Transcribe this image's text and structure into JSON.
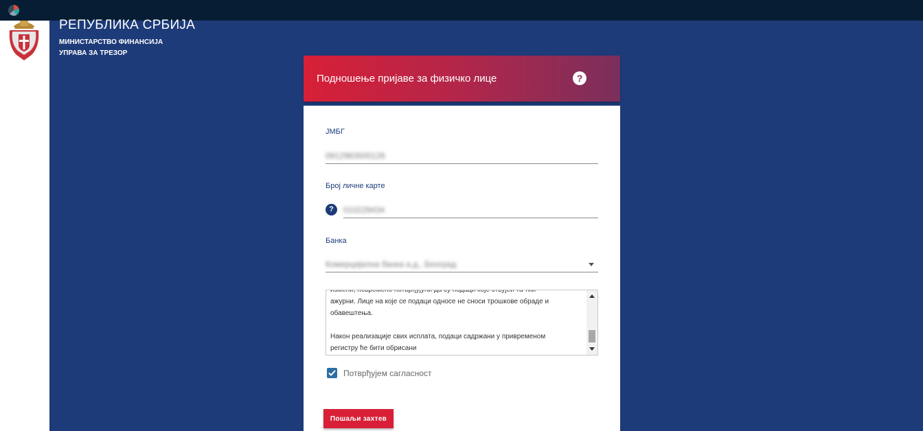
{
  "header": {
    "title": "РЕПУБЛИКА СРБИЈА",
    "ministry": "МИНИСТАРСТВО ФИНАНСИЈА",
    "agency": "УПРАВА ЗА ТРЕЗОР"
  },
  "form": {
    "title": "Подношење пријаве за физичко лице",
    "help_label": "?",
    "jmbg_label": "ЈМБГ",
    "jmbg_value": "0912983500126",
    "id_card_label": "Број личне карте",
    "id_card_help": "?",
    "id_card_value": "010229434",
    "bank_label": "Банка",
    "bank_value": "Комерцијална банка а.д., Београд",
    "terms_lines": [
      "измени, повремено потврђујући да су подаци које ствујеи та тии",
      "ажурни. Лице на које се подаци односе не сноси трошкове обраде и",
      "обавештења.",
      "",
      "Након реализације свих исплата, подаци садржани у привременом",
      "регистру ће бити обрисани"
    ],
    "consent_label": "Потврђујем сагласност",
    "consent_checked": true,
    "submit_label": "Пошаљи захтев"
  },
  "colors": {
    "background_blue": "#1d3b79",
    "accent_red": "#d81f37",
    "topbar": "#071d33",
    "checkbox": "#2c6fa3"
  }
}
